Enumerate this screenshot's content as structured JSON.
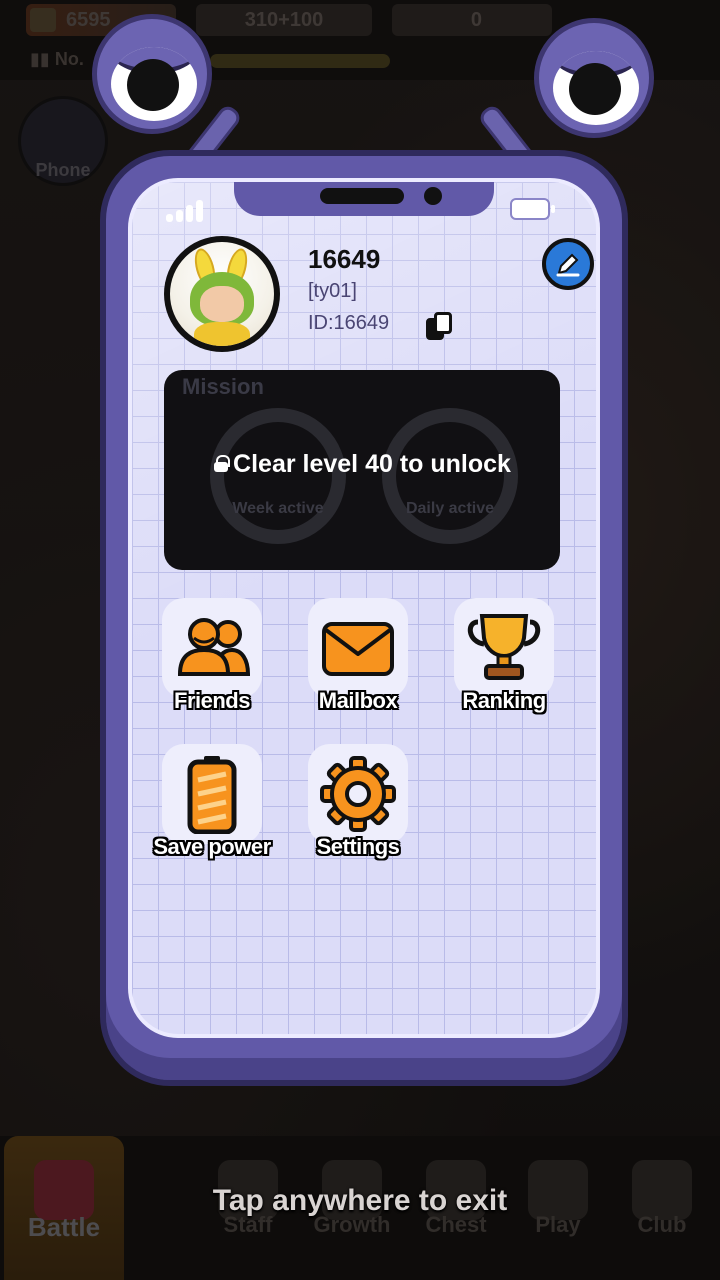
{
  "hud": {
    "resource_1": "6595",
    "resource_2": "310+100",
    "resource_3": "0",
    "rank_prefix": "No.",
    "phone_label": "Phone"
  },
  "popup": {
    "profile": {
      "name": "16649",
      "tag": "[ty01]",
      "id_text": "ID:16649"
    },
    "mission": {
      "title": "Mission",
      "lock_message": "Clear level 40 to unlock",
      "week_label": "Week active",
      "daily_label": "Daily active"
    },
    "apps": [
      {
        "label": "Friends"
      },
      {
        "label": "Mailbox"
      },
      {
        "label": "Ranking"
      },
      {
        "label": "Save power"
      },
      {
        "label": "Settings"
      }
    ]
  },
  "bottom_nav": {
    "items": [
      {
        "label": "Battle"
      },
      {
        "label": "Staff"
      },
      {
        "label": "Growth"
      },
      {
        "label": "Chest"
      },
      {
        "label": "Play"
      },
      {
        "label": "Club"
      }
    ],
    "active": "Battle"
  },
  "overlay_hint": "Tap anywhere to exit",
  "colors": {
    "phone_frame": "#6159a8",
    "screen": "#dcdcf8",
    "accent_orange": "#f7931e",
    "edit_blue": "#2a79d8"
  }
}
